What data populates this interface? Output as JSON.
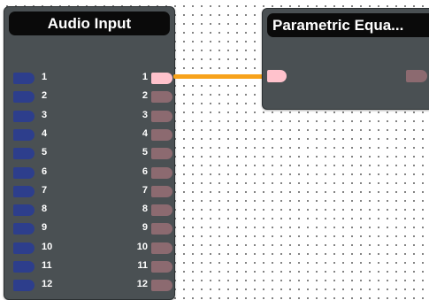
{
  "canvas": {
    "background": "#ffffff",
    "grid_dots": "#6b6b6b"
  },
  "nodes": {
    "audio_input": {
      "title": "Audio Input",
      "inputs": [
        "1",
        "2",
        "3",
        "4",
        "5",
        "6",
        "7",
        "8",
        "9",
        "10",
        "11",
        "12"
      ],
      "outputs": [
        "1",
        "2",
        "3",
        "4",
        "5",
        "6",
        "7",
        "8",
        "9",
        "10",
        "11",
        "12"
      ],
      "active_output": "1"
    },
    "parametric_eq": {
      "title": "Parametric Equa..."
    }
  },
  "connection": {
    "from": "Audio Input 1",
    "to": "Parametric Equa... input",
    "color": "#f7a21b"
  },
  "colors": {
    "node_body": "#4a5053",
    "title_bar": "#0a0a0a",
    "input_port": "#2d3e8c",
    "output_port": "#8c6a70",
    "output_port_active": "#ffc2cc"
  }
}
